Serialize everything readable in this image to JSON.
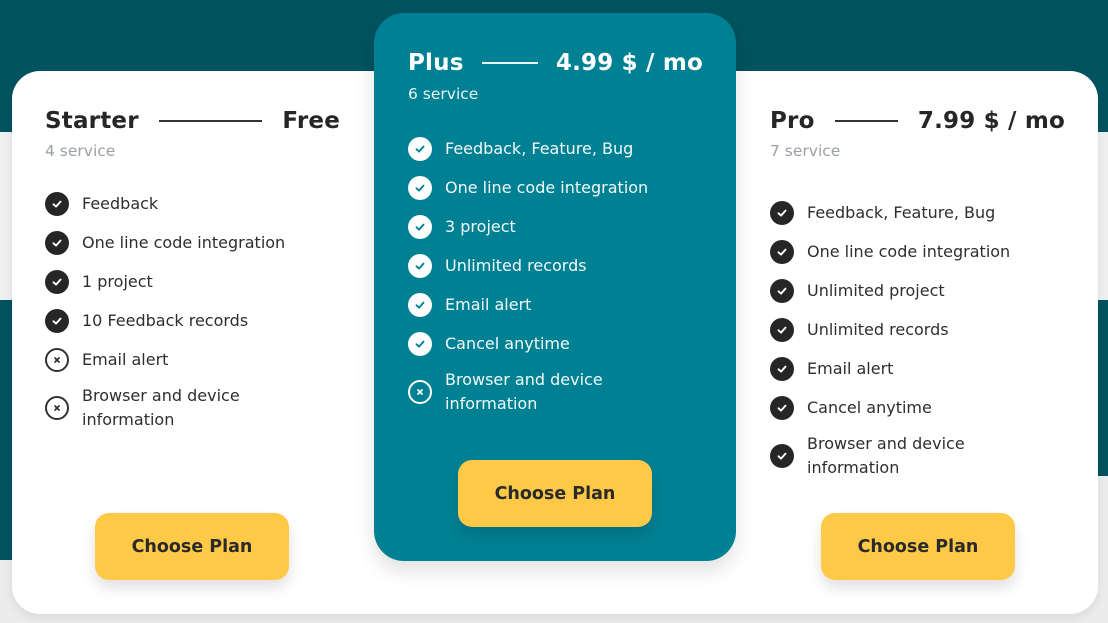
{
  "colors": {
    "background_dark": "#01535f",
    "plus_card": "#008193",
    "button": "#fdc947",
    "text_dark": "#262626",
    "muted": "#9aa0a6"
  },
  "plans": [
    {
      "id": "starter",
      "name": "Starter",
      "price": "Free",
      "service_count": "4 service",
      "features": [
        {
          "label": "Feedback",
          "included": true,
          "icon": "check-circle-icon"
        },
        {
          "label": "One line code integration",
          "included": true,
          "icon": "check-circle-icon"
        },
        {
          "label": "1 project",
          "included": true,
          "icon": "check-circle-icon"
        },
        {
          "label": "10 Feedback records",
          "included": true,
          "icon": "check-circle-icon"
        },
        {
          "label": "Email alert",
          "included": false,
          "icon": "x-circle-icon"
        },
        {
          "label": "Browser and device information",
          "included": false,
          "icon": "x-circle-icon"
        }
      ],
      "button_label": "Choose Plan"
    },
    {
      "id": "plus",
      "name": "Plus",
      "price": "4.99 $ / mo",
      "service_count": "6 service",
      "highlighted": true,
      "features": [
        {
          "label": "Feedback, Feature, Bug",
          "included": true,
          "icon": "check-circle-icon"
        },
        {
          "label": "One line code integration",
          "included": true,
          "icon": "check-circle-icon"
        },
        {
          "label": "3 project",
          "included": true,
          "icon": "check-circle-icon"
        },
        {
          "label": "Unlimited records",
          "included": true,
          "icon": "check-circle-icon"
        },
        {
          "label": "Email alert",
          "included": true,
          "icon": "check-circle-icon"
        },
        {
          "label": "Cancel anytime",
          "included": true,
          "icon": "check-circle-icon"
        },
        {
          "label": "Browser and device information",
          "included": false,
          "icon": "x-circle-icon"
        }
      ],
      "button_label": "Choose Plan"
    },
    {
      "id": "pro",
      "name": "Pro",
      "price": "7.99 $ / mo",
      "service_count": "7 service",
      "features": [
        {
          "label": "Feedback, Feature, Bug",
          "included": true,
          "icon": "check-circle-icon"
        },
        {
          "label": "One line code integration",
          "included": true,
          "icon": "check-circle-icon"
        },
        {
          "label": "Unlimited project",
          "included": true,
          "icon": "check-circle-icon"
        },
        {
          "label": "Unlimited records",
          "included": true,
          "icon": "check-circle-icon"
        },
        {
          "label": "Email alert",
          "included": true,
          "icon": "check-circle-icon"
        },
        {
          "label": "Cancel anytime",
          "included": true,
          "icon": "check-circle-icon"
        },
        {
          "label": "Browser and device information",
          "included": true,
          "icon": "check-circle-icon"
        }
      ],
      "button_label": "Choose Plan"
    }
  ]
}
